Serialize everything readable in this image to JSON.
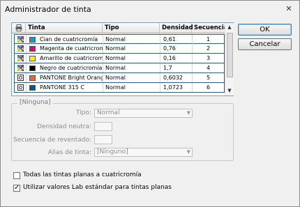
{
  "window": {
    "title": "Administrador de tinta",
    "close_glyph": "✕"
  },
  "table": {
    "columns": [
      "Tinta",
      "Tipo",
      "Densidad",
      "Secuencia"
    ],
    "rows": [
      {
        "icon": "process-ink-icon",
        "swatch": "#00a0dc",
        "name": "Cian de cuatricromía",
        "type": "Normal",
        "density": "0,61",
        "sequence": "1"
      },
      {
        "icon": "process-ink-icon",
        "swatch": "#e4007f",
        "name": "Magenta de cuatricromía",
        "type": "Normal",
        "density": "0,76",
        "sequence": "2"
      },
      {
        "icon": "process-ink-icon",
        "swatch": "#fff200",
        "name": "Amarillo de cuatricromía",
        "type": "Normal",
        "density": "0,16",
        "sequence": "3"
      },
      {
        "icon": "process-ink-icon",
        "swatch": "#000000",
        "name": "Negro de cuatricromía",
        "type": "Normal",
        "density": "1,7",
        "sequence": "4"
      },
      {
        "icon": "spot-ink-icon",
        "swatch": "#f26522",
        "name": "PANTONE Bright Orange C",
        "type": "Normal",
        "density": "0,6032",
        "sequence": "5"
      },
      {
        "icon": "spot-ink-icon",
        "swatch": "#00598a",
        "name": "PANTONE 315 C",
        "type": "Normal",
        "density": "1,0723",
        "sequence": "6"
      }
    ]
  },
  "buttons": {
    "ok": "OK",
    "cancel": "Cancelar"
  },
  "group": {
    "legend": "[Ninguna]",
    "type_label": "Tipo:",
    "type_value": "Normal",
    "density_label": "Densidad neutra:",
    "sequence_label": "Secuencia de reventado:",
    "alias_label": "Alias de tinta:",
    "alias_value": "[Ninguno]"
  },
  "options": {
    "all_spots_label": "Todas las tintas planas a cuatricromía",
    "all_spots_checked": false,
    "lab_label": "Utilizar valores Lab estándar para tintas planas",
    "lab_checked": true
  }
}
